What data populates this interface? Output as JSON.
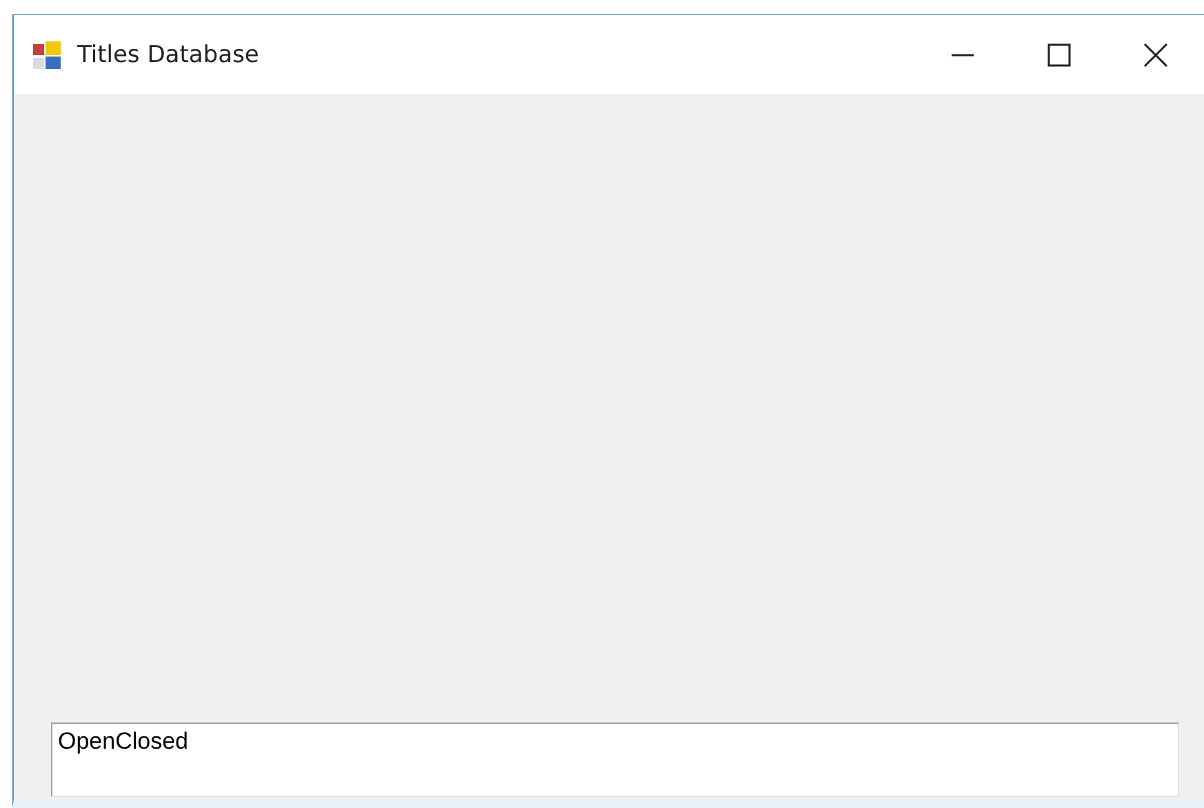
{
  "window": {
    "title": "Titles Database"
  },
  "text_box": {
    "value": "OpenClosed"
  }
}
